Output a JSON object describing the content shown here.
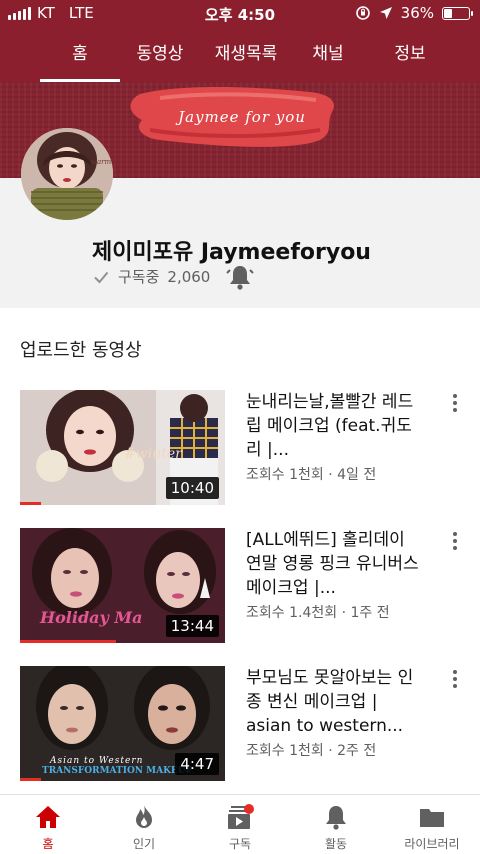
{
  "status_bar": {
    "carrier": "KT",
    "network": "LTE",
    "time": "오후 4:50",
    "battery": "36%",
    "battery_level": 0.36
  },
  "tabs": [
    {
      "label": "홈",
      "active": true
    },
    {
      "label": "동영상",
      "active": false
    },
    {
      "label": "재생목록",
      "active": false
    },
    {
      "label": "채널",
      "active": false
    },
    {
      "label": "정보",
      "active": false
    }
  ],
  "banner": {
    "text": "Jaymee for you"
  },
  "channel": {
    "name": "제이미포유 Jaymeeforyou",
    "subscribed_label": "구독중",
    "subscriber_count": "2,060",
    "avatar_text": "warm"
  },
  "section": {
    "title": "업로드한 동영상"
  },
  "videos": [
    {
      "title": "눈내리는날,볼빨간 레드립 메이크업 (feat.귀도리 |...",
      "meta": "조회수 1천회 · 4일 전",
      "duration": "10:40",
      "caption": "#winter",
      "watched": 0.1
    },
    {
      "title": "[ALL에뛰드] 홀리데이 연말 영롱 핑크 유니버스 메이크업 |...",
      "meta": "조회수 1.4천회 · 1주 전",
      "duration": "13:44",
      "caption": "Holiday Ma",
      "watched": 0.47
    },
    {
      "title": "부모님도 못알아보는 인종 변신 메이크업 | asian to western...",
      "meta": "조회수 1천회 · 2주 전",
      "duration": "4:47",
      "caption": "Asian to Western",
      "caption2": "TRANSFORMATION MAKEUP",
      "watched": 0.1
    }
  ],
  "bottom_nav": [
    {
      "label": "홈",
      "icon": "home-icon",
      "active": true
    },
    {
      "label": "인기",
      "icon": "flame-icon",
      "active": false
    },
    {
      "label": "구독",
      "icon": "subscriptions-icon",
      "active": false
    },
    {
      "label": "활동",
      "icon": "bell-icon",
      "active": false
    },
    {
      "label": "라이브러리",
      "icon": "folder-icon",
      "active": false
    }
  ],
  "colors": {
    "brand": "#8c1f2e",
    "accent_red": "#e52d27",
    "active_nav": "#cc0000"
  }
}
